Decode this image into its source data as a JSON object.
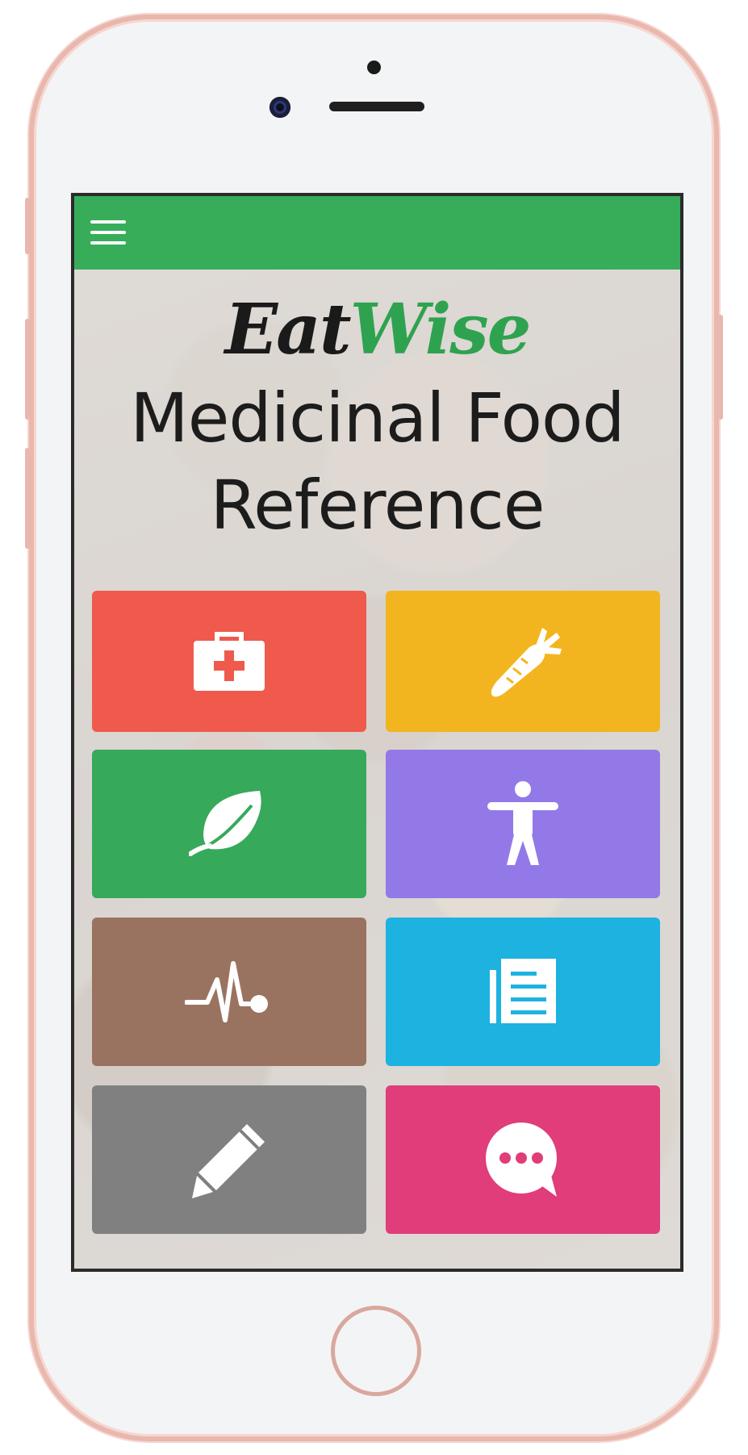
{
  "app": {
    "logo_part1": "Eat",
    "logo_part2": "Wise",
    "subtitle_line1": "Medicinal Food",
    "subtitle_line2": "Reference"
  },
  "colors": {
    "topbar": "#37ad5a",
    "logo_accent": "#2fa250"
  },
  "menu": {
    "icon": "hamburger-menu-icon"
  },
  "tiles": [
    {
      "icon": "first-aid-kit-icon",
      "color": "#ef5a4d"
    },
    {
      "icon": "carrot-icon",
      "color": "#f3b51f"
    },
    {
      "icon": "leaf-icon",
      "color": "#37a95b"
    },
    {
      "icon": "body-figure-icon",
      "color": "#9379e8"
    },
    {
      "icon": "heartbeat-pulse-icon",
      "color": "#9a7360"
    },
    {
      "icon": "notes-document-icon",
      "color": "#1db2e0"
    },
    {
      "icon": "pencil-icon",
      "color": "#808080"
    },
    {
      "icon": "chat-bubble-icon",
      "color": "#e03d7a"
    }
  ]
}
